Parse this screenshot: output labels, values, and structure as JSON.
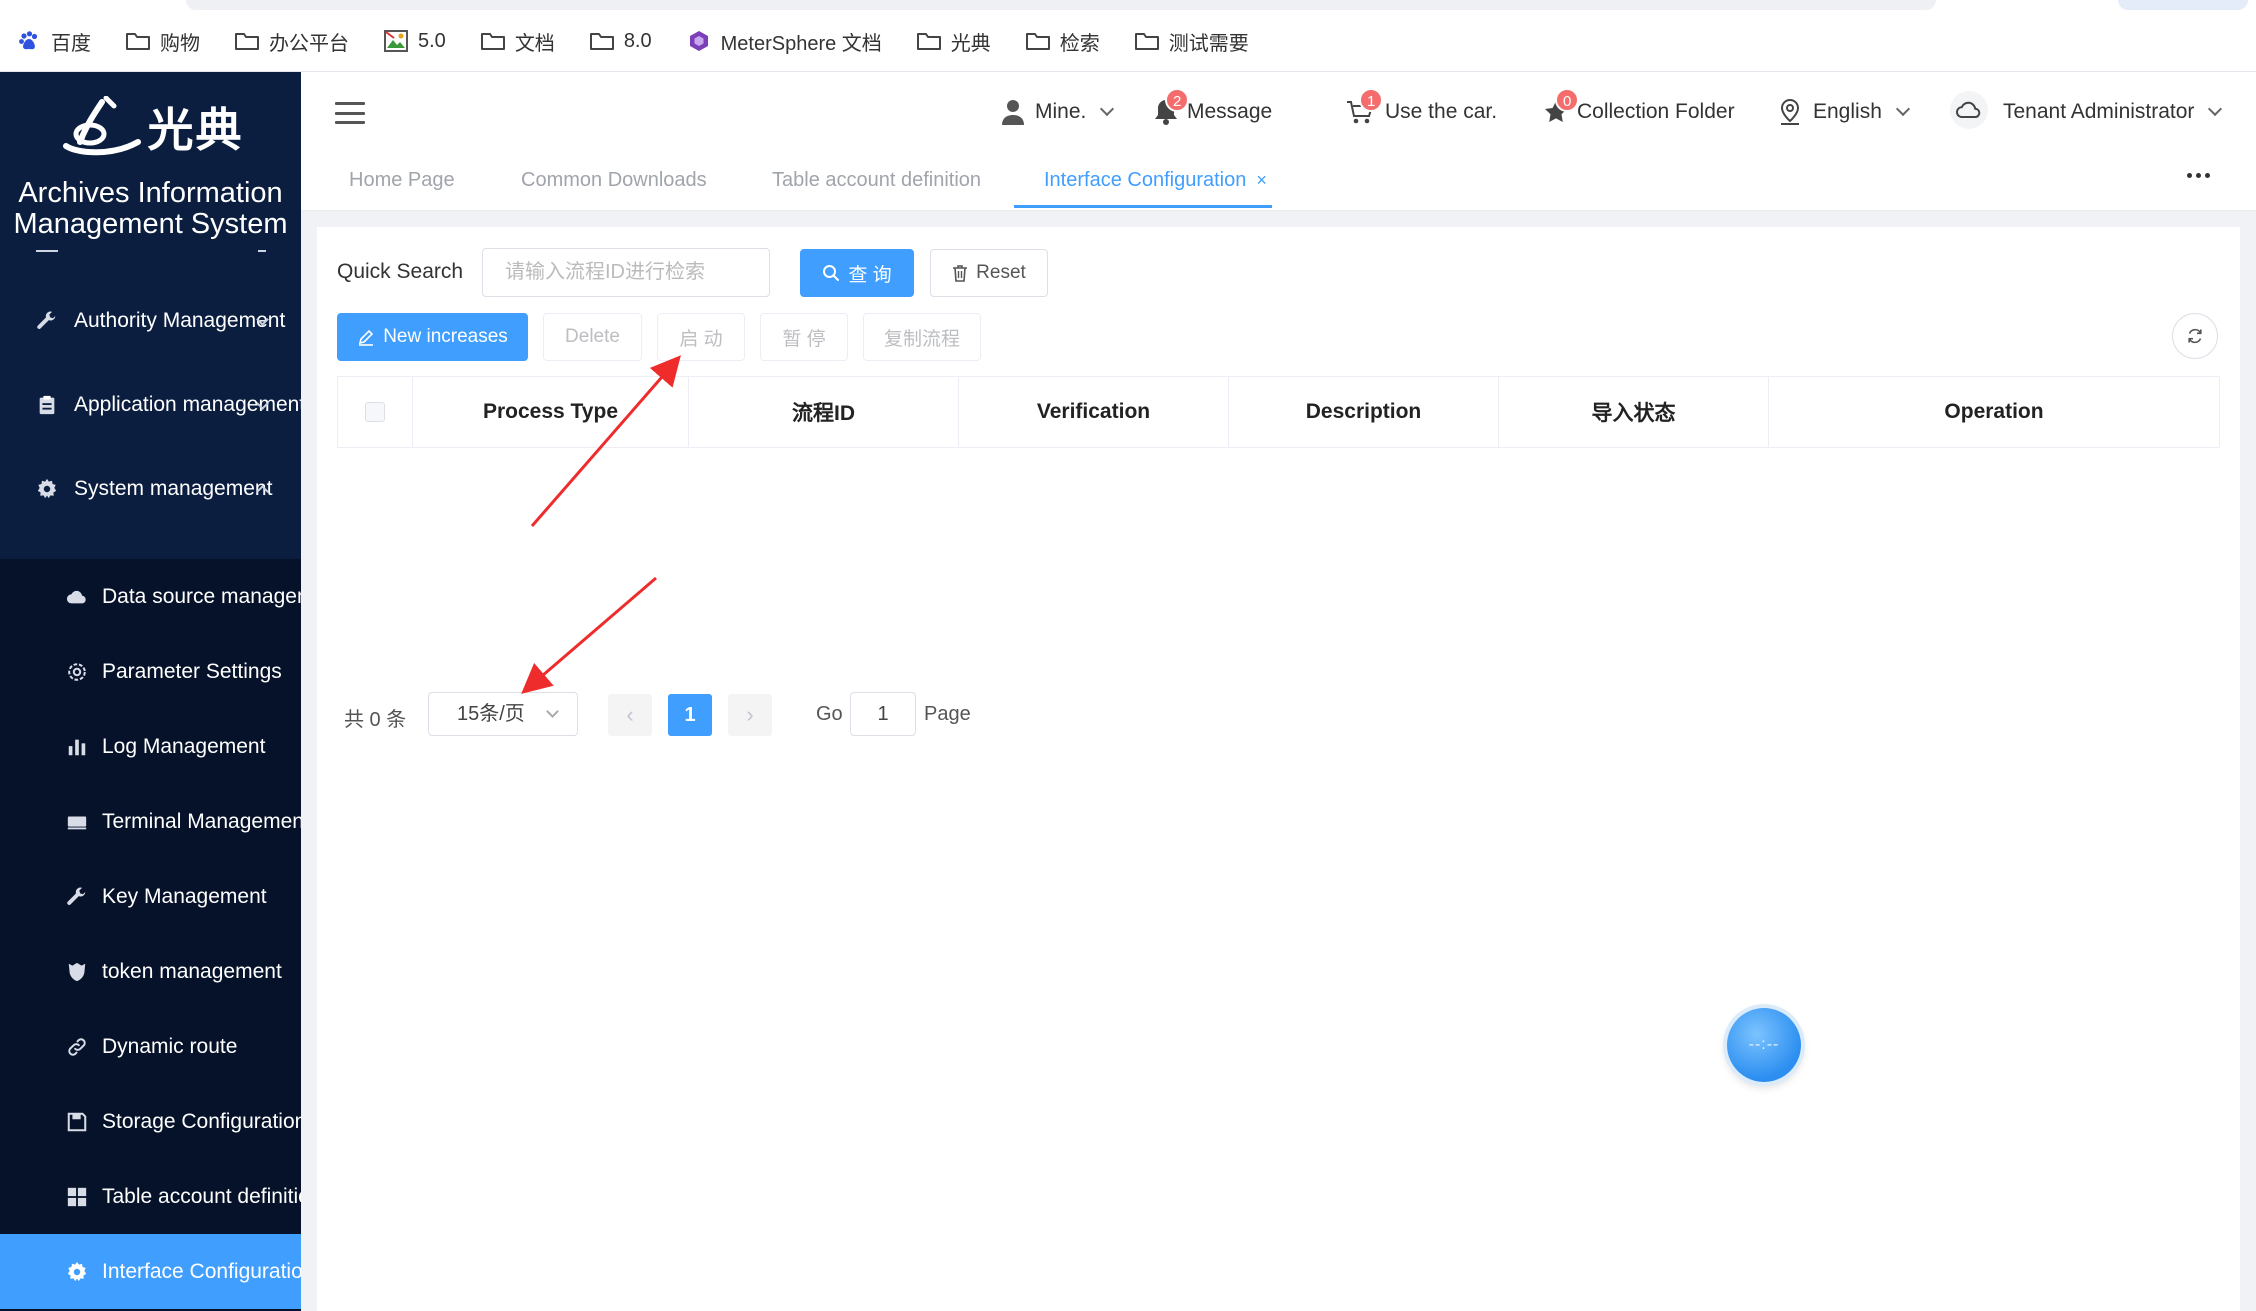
{
  "bookmarks": [
    {
      "label": "百度",
      "icon": "baidu-paw-icon"
    },
    {
      "label": "购物",
      "icon": "folder-icon"
    },
    {
      "label": "办公平台",
      "icon": "folder-icon"
    },
    {
      "label": "5.0",
      "icon": "image-icon"
    },
    {
      "label": "文档",
      "icon": "folder-icon"
    },
    {
      "label": "8.0",
      "icon": "folder-icon"
    },
    {
      "label": "MeterSphere 文档",
      "icon": "metersphere-icon"
    },
    {
      "label": "光典",
      "icon": "folder-icon"
    },
    {
      "label": "检索",
      "icon": "folder-icon"
    },
    {
      "label": "测试需要",
      "icon": "folder-icon"
    }
  ],
  "brand": {
    "logo_text": "光典",
    "system_title_line1": "Archives Information",
    "system_title_line2": "Management System"
  },
  "sidebar": {
    "items": [
      {
        "label": "Authority Management",
        "icon": "wrench-icon"
      },
      {
        "label": "Application management",
        "icon": "clipboard-icon"
      },
      {
        "label": "System management",
        "icon": "gear-icon"
      }
    ],
    "sub_items": [
      {
        "label": "Data source management",
        "icon": "cloud-icon"
      },
      {
        "label": "Parameter Settings",
        "icon": "settings-icon"
      },
      {
        "label": "Log Management",
        "icon": "bar-chart-icon"
      },
      {
        "label": "Terminal Management",
        "icon": "monitor-icon"
      },
      {
        "label": "Key Management",
        "icon": "key-icon"
      },
      {
        "label": "token management",
        "icon": "shield-icon"
      },
      {
        "label": "Dynamic route",
        "icon": "link-icon"
      },
      {
        "label": "Storage Configuration",
        "icon": "save-icon"
      },
      {
        "label": "Table account definition",
        "icon": "grid-icon"
      },
      {
        "label": "Interface Configuration",
        "icon": "gear-icon"
      }
    ],
    "active_sub_item": "Interface Configuration"
  },
  "header": {
    "user_label": "Mine.",
    "message_label": "Message",
    "message_badge": "2",
    "car_label": "Use the car.",
    "car_badge": "1",
    "collection_label": "Collection Folder",
    "collection_badge": "0",
    "language_label": "English",
    "tenant_label": "Tenant Administrator"
  },
  "tabs": [
    {
      "label": "Home Page",
      "active": false
    },
    {
      "label": "Common Downloads",
      "active": false
    },
    {
      "label": "Table account definition",
      "active": false
    },
    {
      "label": "Interface Configuration",
      "active": true
    }
  ],
  "toolbar": {
    "quick_search_label": "Quick Search",
    "search_placeholder": "请输入流程ID进行检索",
    "query_label": "查 询",
    "reset_label": "Reset",
    "new_label": "New increases",
    "delete_label": "Delete",
    "start_label": "启 动",
    "pause_label": "暂 停",
    "copy_label": "复制流程"
  },
  "table": {
    "columns": [
      "Process Type",
      "流程ID",
      "Verification",
      "Description",
      "导入状态",
      "Operation"
    ],
    "rows": []
  },
  "pagination": {
    "total_label": "共 0 条",
    "page_size_label": "15条/页",
    "current_page": "1",
    "go_label": "Go",
    "go_value": "1",
    "page_label": "Page"
  },
  "float_clock": {
    "text": "--:--"
  },
  "colors": {
    "sidebar_bg": "#0b1e3f",
    "accent": "#409eff",
    "badge": "#f56c6c",
    "annotation_arrow": "#ee2c2c"
  }
}
